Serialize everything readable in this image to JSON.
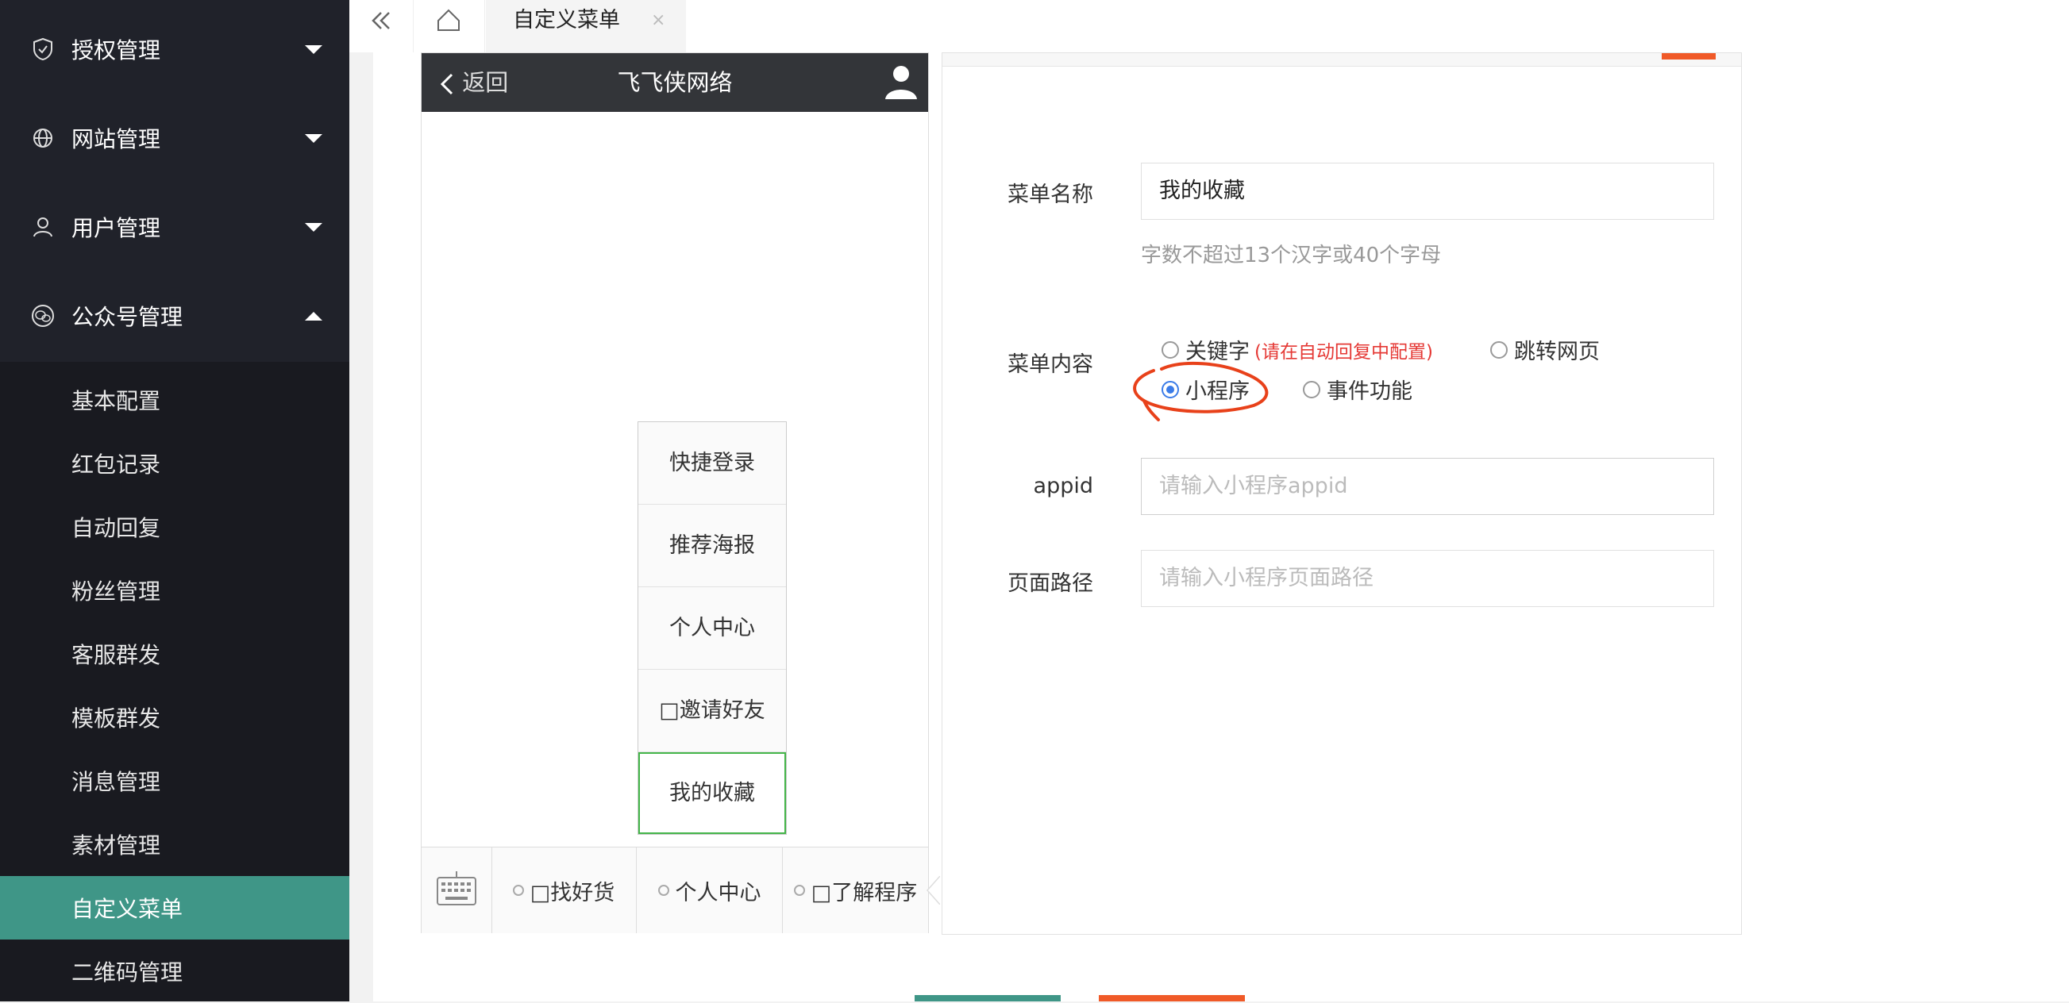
{
  "sidebar": {
    "groups": [
      {
        "label": "授权管理",
        "icon": "shield-icon",
        "expanded": false
      },
      {
        "label": "网站管理",
        "icon": "globe-icon",
        "expanded": false
      },
      {
        "label": "用户管理",
        "icon": "user-icon",
        "expanded": false
      },
      {
        "label": "公众号管理",
        "icon": "wechat-icon",
        "expanded": true
      }
    ],
    "sub_items": [
      {
        "label": "基本配置"
      },
      {
        "label": "红包记录"
      },
      {
        "label": "自动回复"
      },
      {
        "label": "粉丝管理"
      },
      {
        "label": "客服群发"
      },
      {
        "label": "模板群发"
      },
      {
        "label": "消息管理"
      },
      {
        "label": "素材管理"
      },
      {
        "label": "自定义菜单",
        "active": true
      },
      {
        "label": "二维码管理"
      }
    ],
    "active_color": "#3f9687"
  },
  "tabbar": {
    "active_tab": "自定义菜单",
    "close_glyph": "×"
  },
  "phone": {
    "back_label": "返回",
    "title": "飞飞侠网络",
    "popup_items": [
      "快捷登录",
      "推荐海报",
      "个人中心",
      "□邀请好友",
      "我的收藏"
    ],
    "selected_popup": "我的收藏",
    "bottom_menus": [
      "□找好货",
      "个人中心",
      "□了解程序"
    ]
  },
  "form": {
    "menu_name_label": "菜单名称",
    "menu_name_value": "我的收藏",
    "menu_name_hint": "字数不超过13个汉字或40个字母",
    "menu_content_label": "菜单内容",
    "options": {
      "keyword": "关键字",
      "keyword_note": "(请在自动回复中配置)",
      "jump_web": "跳转网页",
      "mini_program": "小程序",
      "event": "事件功能"
    },
    "selected_option": "小程序",
    "appid_label": "appid",
    "appid_placeholder": "请输入小程序appid",
    "path_label": "页面路径",
    "path_placeholder": "请输入小程序页面路径"
  }
}
